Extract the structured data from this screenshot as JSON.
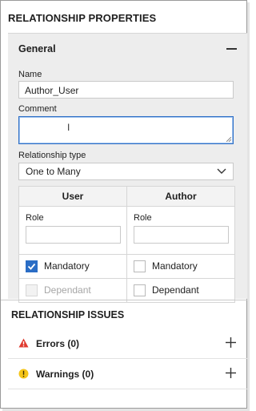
{
  "panel": {
    "title": "RELATIONSHIP PROPERTIES"
  },
  "general": {
    "title": "General",
    "name_label": "Name",
    "name_value": "Author_User",
    "comment_label": "Comment",
    "comment_value": "",
    "relationship_type_label": "Relationship type",
    "relationship_type_value": "One to Many"
  },
  "table": {
    "columns": [
      "User",
      "Author"
    ],
    "role_label": "Role",
    "rows": [
      {
        "left": {
          "label": "Mandatory",
          "checked": true,
          "disabled": false
        },
        "right": {
          "label": "Mandatory",
          "checked": false,
          "disabled": false
        }
      },
      {
        "left": {
          "label": "Dependant",
          "checked": false,
          "disabled": true
        },
        "right": {
          "label": "Dependant",
          "checked": false,
          "disabled": false
        }
      }
    ]
  },
  "issues": {
    "title": "RELATIONSHIP ISSUES",
    "errors_label": "Errors (0)",
    "warnings_label": "Warnings (0)"
  },
  "colors": {
    "accent": "#2a6dc5",
    "error": "#e03a2f",
    "warning": "#f5c518"
  }
}
